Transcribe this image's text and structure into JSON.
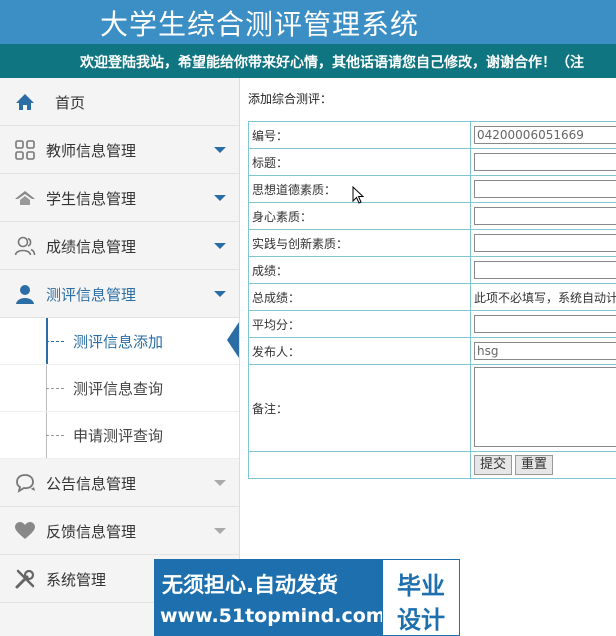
{
  "header": {
    "title": "大学生综合测评管理系统"
  },
  "marquee": {
    "text": "欢迎登陆我站，希望能给你带来好心情，其他话语请您自己修改，谢谢合作！（注"
  },
  "sidebar": {
    "home": "首页",
    "items": [
      {
        "label": "教师信息管理",
        "icon": "grid-icon"
      },
      {
        "label": "学生信息管理",
        "icon": "house-icon"
      },
      {
        "label": "成绩信息管理",
        "icon": "users-icon"
      },
      {
        "label": "测评信息管理",
        "icon": "user-icon"
      }
    ],
    "sub_items": [
      "测评信息添加",
      "测评信息查询",
      "申请测评查询"
    ],
    "items_after": [
      {
        "label": "公告信息管理",
        "icon": "chat-icon"
      },
      {
        "label": "反馈信息管理",
        "icon": "heart-icon"
      },
      {
        "label": "系统管理",
        "icon": "tools-icon"
      }
    ]
  },
  "form": {
    "title": "添加综合测评：",
    "fields": {
      "number_label": "编号：",
      "number_value": "04200006051669",
      "title_label": "标题：",
      "moral_label": "思想道德素质：",
      "physical_label": "身心素质：",
      "practice_label": "实践与创新素质：",
      "score_label": "成绩：",
      "total_label": "总成绩：",
      "total_hint": "此项不必填写，系统自动计",
      "average_label": "平均分：",
      "publisher_label": "发布人：",
      "publisher_value": "hsg",
      "remark_label": "备注："
    },
    "submit": "提交",
    "reset": "重置"
  },
  "banner": {
    "line1": "无须担心.自动发货",
    "line2": "www.51topmind.com",
    "right1": "毕业",
    "right2": "设计"
  },
  "colors": {
    "header": "#3b8fc4",
    "marquee": "#0f7580",
    "accent": "#2a6ea5",
    "border": "#7fc6d3"
  }
}
